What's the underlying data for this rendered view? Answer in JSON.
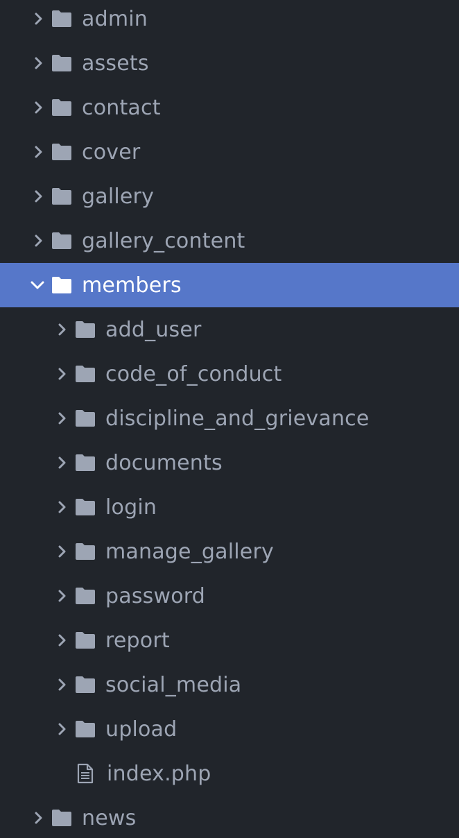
{
  "colors": {
    "background": "#21252b",
    "text": "#9da5b4",
    "selected_background": "#5677c9",
    "selected_text": "#ffffff",
    "folder_icon": "#9da5b4"
  },
  "tree": {
    "items": [
      {
        "label": "admin",
        "type": "folder",
        "expanded": false
      },
      {
        "label": "assets",
        "type": "folder",
        "expanded": false
      },
      {
        "label": "contact",
        "type": "folder",
        "expanded": false
      },
      {
        "label": "cover",
        "type": "folder",
        "expanded": false
      },
      {
        "label": "gallery",
        "type": "folder",
        "expanded": false
      },
      {
        "label": "gallery_content",
        "type": "folder",
        "expanded": false
      },
      {
        "label": "members",
        "type": "folder",
        "expanded": true,
        "selected": true
      },
      {
        "label": "add_user",
        "type": "folder",
        "expanded": false
      },
      {
        "label": "code_of_conduct",
        "type": "folder",
        "expanded": false
      },
      {
        "label": "discipline_and_grievance",
        "type": "folder",
        "expanded": false
      },
      {
        "label": "documents",
        "type": "folder",
        "expanded": false
      },
      {
        "label": "login",
        "type": "folder",
        "expanded": false
      },
      {
        "label": "manage_gallery",
        "type": "folder",
        "expanded": false
      },
      {
        "label": "password",
        "type": "folder",
        "expanded": false
      },
      {
        "label": "report",
        "type": "folder",
        "expanded": false
      },
      {
        "label": "social_media",
        "type": "folder",
        "expanded": false
      },
      {
        "label": "upload",
        "type": "folder",
        "expanded": false
      },
      {
        "label": "index.php",
        "type": "file"
      },
      {
        "label": "news",
        "type": "folder",
        "expanded": false
      }
    ]
  }
}
